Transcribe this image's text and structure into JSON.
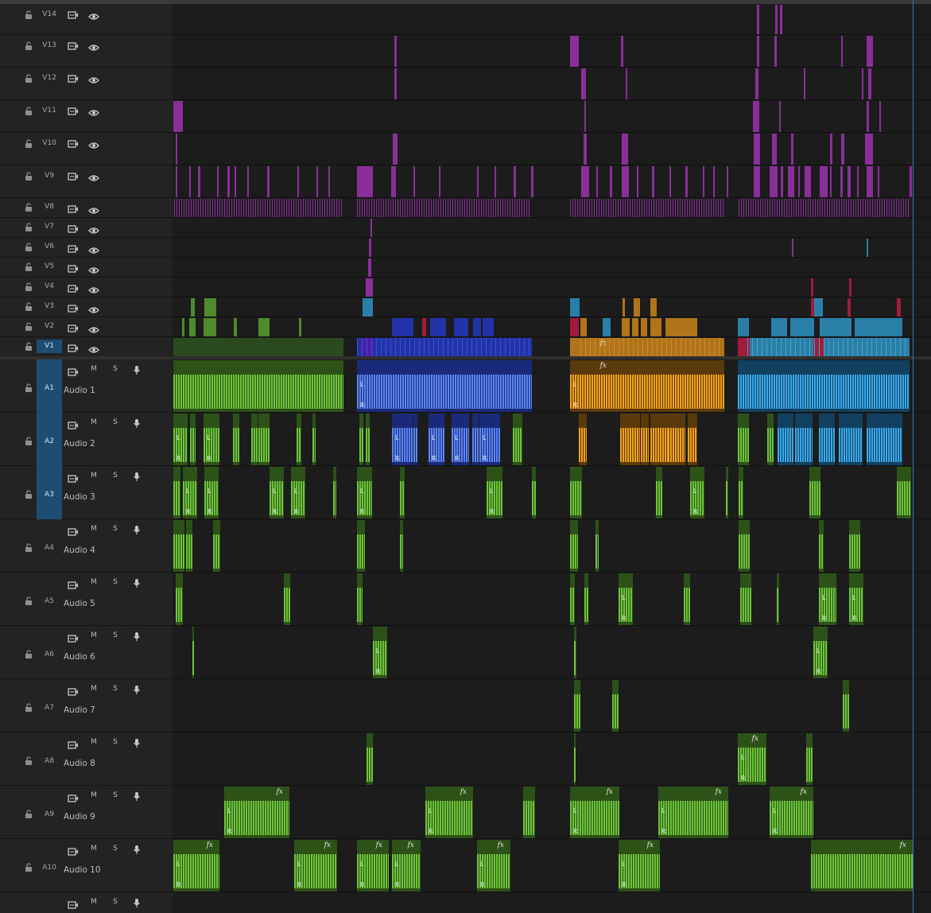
{
  "colors": {
    "panel": "#232323",
    "lane": "#1c1c1c",
    "target_active": "#1e4d73",
    "purple_clip": "#8a2f9a",
    "green_clip": "#4f8a2c",
    "green_audio": "#6cc43a",
    "blue_clip": "#2233a8",
    "blue_audio": "#5b86f0",
    "orange_clip": "#b0741a",
    "orange_audio": "#f2a11b",
    "teal_clip": "#2a7fa8",
    "teal_audio": "#3aa8e8",
    "red_clip": "#a01c3a",
    "playhead": "#3b73c4"
  },
  "icons": {
    "lock": "lock-icon",
    "sync": "film-sync-icon",
    "eye": "eye-icon",
    "mic": "microphone-icon"
  },
  "video_tracks": [
    {
      "id": "V14"
    },
    {
      "id": "V13"
    },
    {
      "id": "V12"
    },
    {
      "id": "V11"
    },
    {
      "id": "V10"
    },
    {
      "id": "V9"
    },
    {
      "id": "V8"
    },
    {
      "id": "V7"
    },
    {
      "id": "V6"
    },
    {
      "id": "V5"
    },
    {
      "id": "V4"
    },
    {
      "id": "V3"
    },
    {
      "id": "V2"
    },
    {
      "id": "V1",
      "target": true
    }
  ],
  "audio_tracks": [
    {
      "id": "A1",
      "name": "Audio 1",
      "target": true
    },
    {
      "id": "A2",
      "name": "Audio 2",
      "target": true
    },
    {
      "id": "A3",
      "name": "Audio 3",
      "target": true
    },
    {
      "id": "A4",
      "name": "Audio 4"
    },
    {
      "id": "A5",
      "name": "Audio 5"
    },
    {
      "id": "A6",
      "name": "Audio 6"
    },
    {
      "id": "A7",
      "name": "Audio 7"
    },
    {
      "id": "A8",
      "name": "Audio 8"
    },
    {
      "id": "A9",
      "name": "Audio 9"
    },
    {
      "id": "A10",
      "name": "Audio 10"
    },
    {
      "id": "",
      "name": ""
    }
  ],
  "audio_buttons": {
    "mute": "M",
    "solo": "S"
  },
  "clip_labels": {
    "left": "L",
    "right": "R",
    "fx": "fx"
  }
}
